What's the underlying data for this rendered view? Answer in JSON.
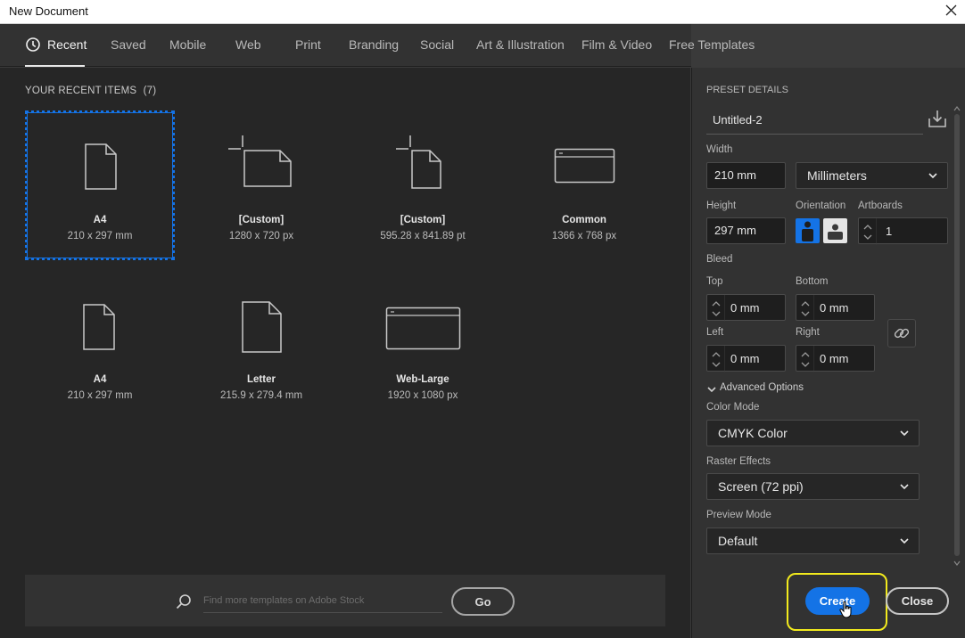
{
  "window": {
    "title": "New Document"
  },
  "tabs": [
    {
      "label": "Recent"
    },
    {
      "label": "Saved"
    },
    {
      "label": "Mobile"
    },
    {
      "label": "Web"
    },
    {
      "label": "Print"
    },
    {
      "label": "Branding"
    },
    {
      "label": "Social"
    },
    {
      "label": "Art & Illustration"
    },
    {
      "label": "Film & Video"
    },
    {
      "label": "Free Templates"
    }
  ],
  "recent": {
    "heading": "YOUR RECENT ITEMS",
    "count": "(7)",
    "items": [
      {
        "name": "A4",
        "dims": "210 x 297 mm",
        "icon": "page-icon"
      },
      {
        "name": "[Custom]",
        "dims": "1280 x 720 px",
        "icon": "landscape-custom-icon"
      },
      {
        "name": "[Custom]",
        "dims": "595.28 x 841.89 pt",
        "icon": "portrait-custom-icon"
      },
      {
        "name": "Common",
        "dims": "1366 x 768 px",
        "icon": "browser-window-icon"
      },
      {
        "name": "A4",
        "dims": "210 x 297 mm",
        "icon": "page-icon"
      },
      {
        "name": "Letter",
        "dims": "215.9 x 279.4 mm",
        "icon": "page-icon"
      },
      {
        "name": "Web-Large",
        "dims": "1920 x 1080 px",
        "icon": "browser-window-icon"
      }
    ]
  },
  "search": {
    "placeholder": "Find more templates on Adobe Stock",
    "go_label": "Go"
  },
  "preset": {
    "heading": "PRESET DETAILS",
    "name": "Untitled-2",
    "width_label": "Width",
    "width": "210 mm",
    "units": "Millimeters",
    "height_label": "Height",
    "height": "297 mm",
    "orientation_label": "Orientation",
    "artboards_label": "Artboards",
    "artboards": "1",
    "bleed_label": "Bleed",
    "top_label": "Top",
    "top": "0 mm",
    "bottom_label": "Bottom",
    "bottom": "0 mm",
    "left_label": "Left",
    "left": "0 mm",
    "right_label": "Right",
    "right": "0 mm",
    "advanced_label": "Advanced Options",
    "color_mode_label": "Color Mode",
    "color_mode": "CMYK Color",
    "raster_label": "Raster Effects",
    "raster": "Screen (72 ppi)",
    "preview_label": "Preview Mode",
    "preview": "Default"
  },
  "actions": {
    "create": "Create",
    "close": "Close"
  },
  "colors": {
    "accent": "#1473e6",
    "highlight": "#f2ea1d"
  }
}
